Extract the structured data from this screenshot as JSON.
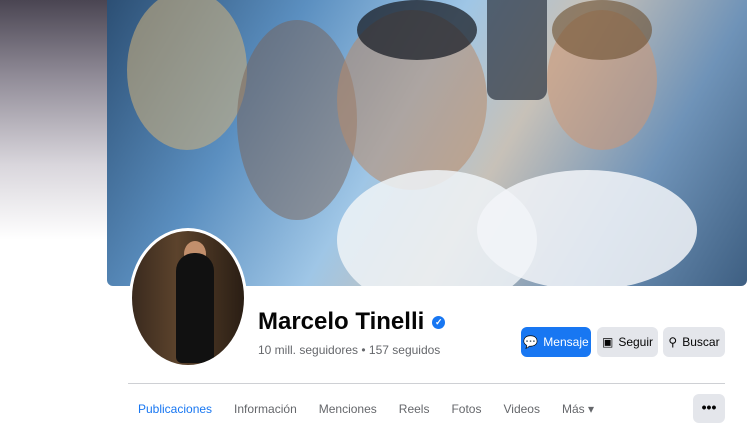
{
  "profile": {
    "name": "Marcelo Tinelli",
    "stats": "10 mill. seguidores • 157 seguidos"
  },
  "actions": {
    "message_label": "Mensaje",
    "follow_label": "Seguir",
    "search_label": "Buscar"
  },
  "tabs": [
    {
      "label": "Publicaciones",
      "active": true
    },
    {
      "label": "Información"
    },
    {
      "label": "Menciones"
    },
    {
      "label": "Reels"
    },
    {
      "label": "Fotos"
    },
    {
      "label": "Videos"
    },
    {
      "label": "Más"
    }
  ],
  "more_button_label": "•••",
  "colors": {
    "accent": "#1877f2",
    "secondary_button": "#e4e6eb",
    "muted_text": "#65676b"
  }
}
